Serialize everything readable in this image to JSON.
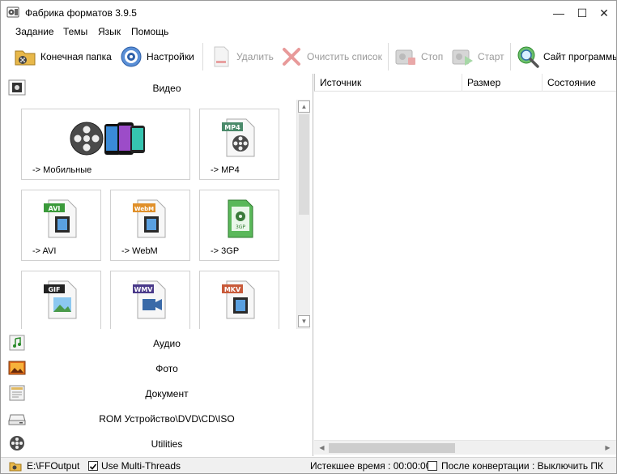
{
  "window": {
    "title": "Фабрика форматов 3.9.5",
    "minimize": "—",
    "maximize": "☐",
    "close": "✕"
  },
  "menu": [
    "Задание",
    "Темы",
    "Язык",
    "Помощь"
  ],
  "toolbar": {
    "output_folder": "Конечная папка",
    "settings": "Настройки",
    "delete": "Удалить",
    "clear_list": "Очистить список",
    "stop": "Стоп",
    "start": "Старт",
    "website": "Сайт программы"
  },
  "categories": {
    "video": "Видео",
    "audio": "Аудио",
    "photo": "Фото",
    "document": "Документ",
    "rom": "ROM Устройство\\DVD\\CD\\ISO",
    "utilities": "Utilities"
  },
  "tiles": {
    "mobile": {
      "label": "-> Мобильные"
    },
    "mp4": {
      "label": "-> MP4",
      "badge": "MP4"
    },
    "avi": {
      "label": "-> AVI",
      "badge": "AVI"
    },
    "webm": {
      "label": "-> WebM",
      "badge": "WebM"
    },
    "3gp": {
      "label": "-> 3GP",
      "badge": "3GP"
    },
    "gif": {
      "label": "",
      "badge": "GIF"
    },
    "wmv": {
      "label": "",
      "badge": "WMV"
    },
    "mkv": {
      "label": "",
      "badge": "MKV"
    }
  },
  "table": {
    "columns": [
      "Источник",
      "Размер",
      "Состояние"
    ]
  },
  "statusbar": {
    "output_path": "E:\\FFOutput",
    "multithreads": "Use Multi-Threads",
    "multithreads_checked": true,
    "elapsed": "Истекшее время : 00:00:00",
    "after_conversion": "После конвертации : Выключить ПК",
    "after_conversion_checked": false
  },
  "icons": {
    "app": "app-icon",
    "folder": "folder-icon",
    "settings": "gear-icon",
    "delete": "document-delete-icon",
    "clear": "red-x-icon",
    "stop": "stop-icon",
    "start": "play-icon",
    "website": "globe-magnifier-icon"
  }
}
